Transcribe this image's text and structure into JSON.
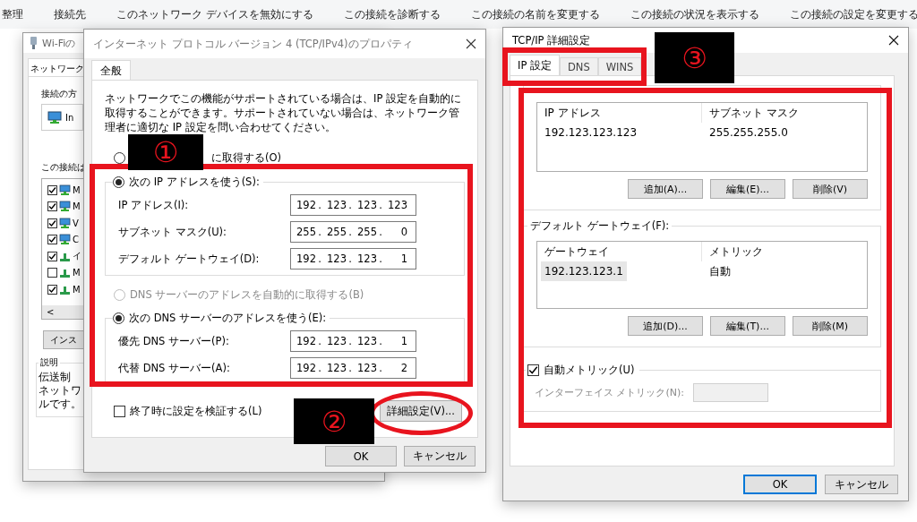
{
  "toolbar": [
    "整理",
    "接続先",
    "このネットワーク デバイスを無効にする",
    "この接続を診断する",
    "この接続の名前を変更する",
    "この接続の状況を表示する",
    "この接続の設定を変更する"
  ],
  "wifi_window": {
    "title": "Wi-Fiの",
    "tabs": [
      {
        "label": "ネットワーク",
        "selected": true
      }
    ],
    "connect_label": "接続の方",
    "adapter": "In",
    "items_label": "この接続は",
    "items": [
      {
        "text": "M",
        "checked": true,
        "kind": "adapter"
      },
      {
        "text": "M",
        "checked": true,
        "kind": "adapter"
      },
      {
        "text": "V",
        "checked": true,
        "kind": "adapter"
      },
      {
        "text": "C",
        "checked": true,
        "kind": "adapter"
      },
      {
        "text": "イ",
        "checked": true,
        "kind": "protocol"
      },
      {
        "text": "M",
        "checked": false,
        "kind": "protocol"
      },
      {
        "text": "M",
        "checked": true,
        "kind": "protocol"
      }
    ],
    "scroll_left": "<",
    "install_button": "インス",
    "description": {
      "title": "説明",
      "lines": [
        "伝送制",
        "ネットワ",
        "ルです。"
      ]
    }
  },
  "ipv4_dialog": {
    "title": "インターネット プロトコル バージョン 4 (TCP/IPv4)のプロパティ",
    "tabs": [
      {
        "label": "全般",
        "selected": true
      }
    ],
    "description": "ネットワークでこの機能がサポートされている場合は、IP 設定を自動的に取得することができます。サポートされていない場合は、ネットワーク管理者に適切な IP 設定を問い合わせてください。",
    "separator": ".",
    "auto_ip": {
      "label": "に取得する(O)",
      "selected": false
    },
    "manual_ip": {
      "label": "次の IP アドレスを使う(S):",
      "selected": true,
      "fields": [
        {
          "label": "IP アドレス(I):",
          "octets": [
            "192",
            "123",
            "123",
            "123"
          ]
        },
        {
          "label": "サブネット マスク(U):",
          "octets": [
            "255",
            "255",
            "255",
            "0"
          ]
        },
        {
          "label": "デフォルト ゲートウェイ(D):",
          "octets": [
            "192",
            "123",
            "123",
            "1"
          ]
        }
      ]
    },
    "auto_dns": {
      "label": "DNS サーバーのアドレスを自動的に取得する(B)",
      "selected": false,
      "disabled": true
    },
    "manual_dns": {
      "label": "次の DNS サーバーのアドレスを使う(E):",
      "selected": true,
      "fields": [
        {
          "label": "優先 DNS サーバー(P):",
          "octets": [
            "192",
            "123",
            "123",
            "1"
          ]
        },
        {
          "label": "代替 DNS サーバー(A):",
          "octets": [
            "192",
            "123",
            "123",
            "2"
          ]
        }
      ]
    },
    "validate": {
      "label": "終了時に設定を検証する(L)",
      "checked": false
    },
    "advanced_button": "詳細設定(V)...",
    "buttons": [
      "OK",
      "キャンセル"
    ]
  },
  "tcpip_dialog": {
    "title": "TCP/IP 詳細設定",
    "tabs": [
      {
        "label": "IP 設定",
        "selected": true
      },
      {
        "label": "DNS",
        "selected": false
      },
      {
        "label": "WINS",
        "selected": false
      }
    ],
    "ip_addresses": {
      "columns": [
        "IP アドレス",
        "サブネット マスク"
      ],
      "rows": [
        {
          "cells": [
            "192.123.123.123",
            "255.255.255.0"
          ],
          "selected": false
        }
      ],
      "buttons": [
        "追加(A)...",
        "編集(E)...",
        "削除(V)"
      ]
    },
    "gateways": {
      "title": "デフォルト ゲートウェイ(F):",
      "columns": [
        "ゲートウェイ",
        "メトリック"
      ],
      "rows": [
        {
          "cells": [
            "192.123.123.1",
            "自動"
          ],
          "selected": true
        }
      ],
      "buttons": [
        "追加(D)...",
        "編集(T)...",
        "削除(M)"
      ]
    },
    "auto_metric": {
      "label": "自動メトリック(U)",
      "checked": true
    },
    "interface_metric": {
      "label": "インターフェイス メトリック(N):",
      "disabled": true
    },
    "buttons": [
      {
        "label": "OK",
        "default": true
      },
      {
        "label": "キャンセル",
        "default": false
      }
    ]
  },
  "annotations": [
    {
      "number": "①"
    },
    {
      "number": "②"
    },
    {
      "number": "③"
    }
  ]
}
